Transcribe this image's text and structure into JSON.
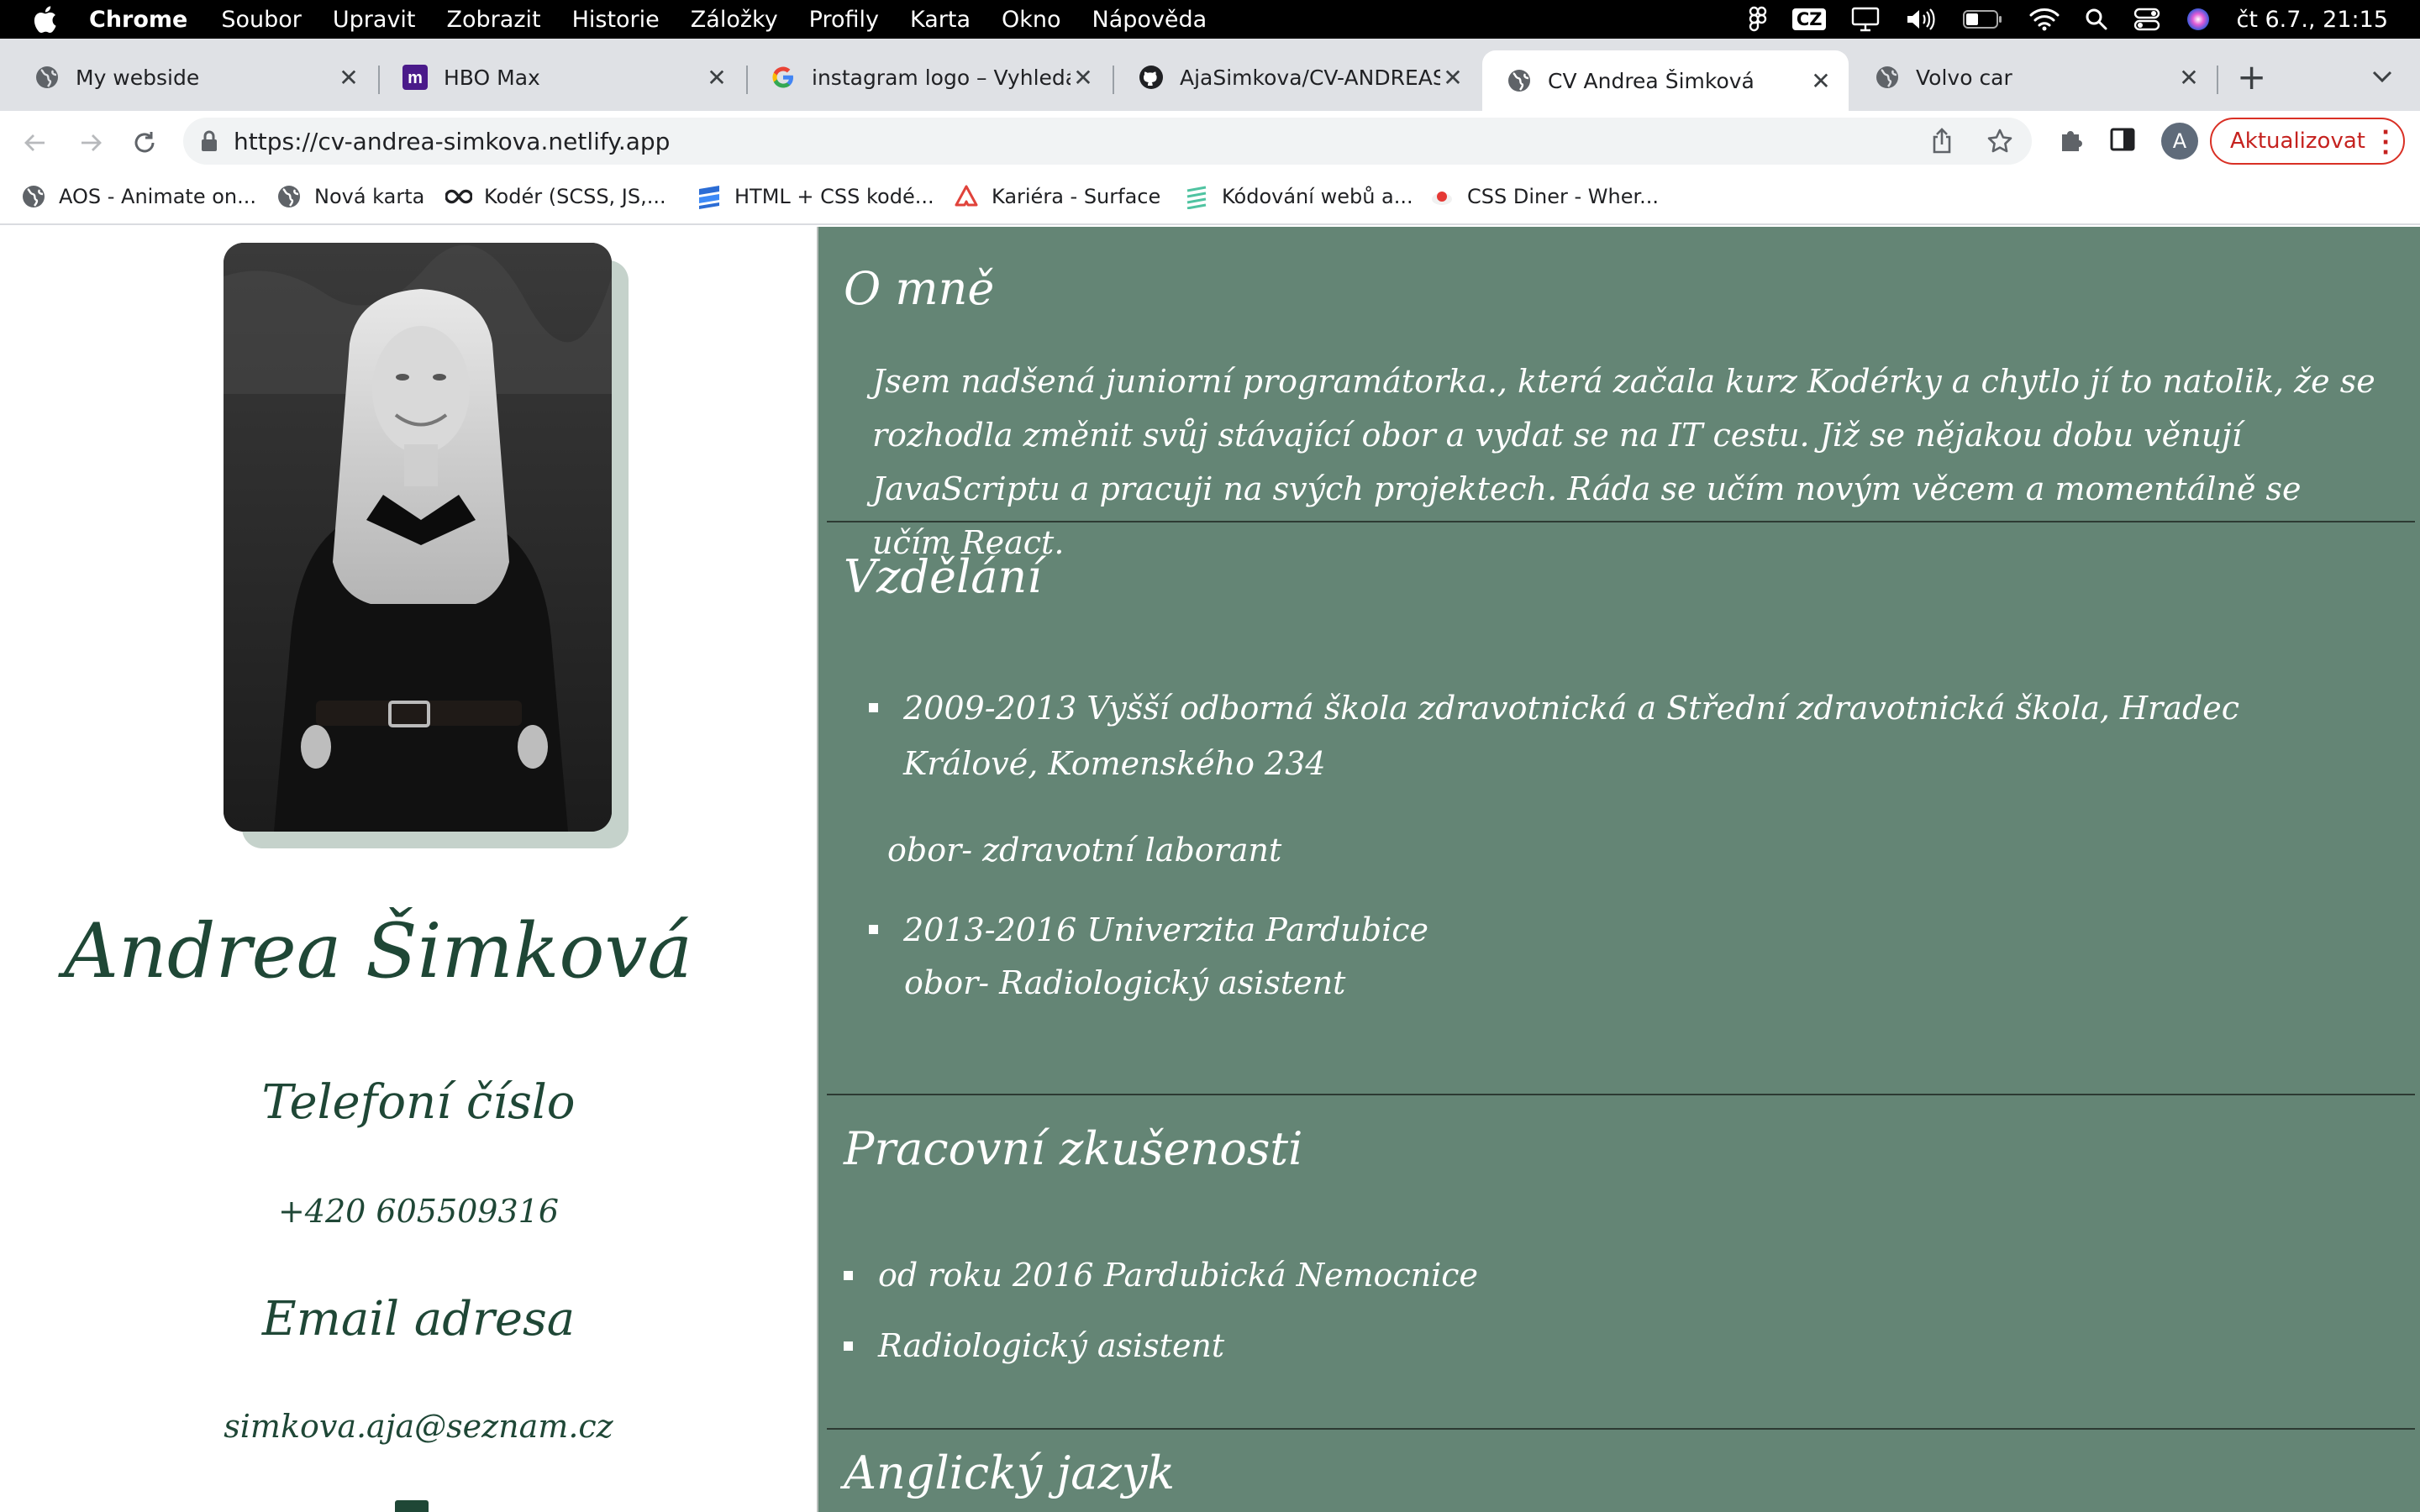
{
  "menubar": {
    "app_name": "Chrome",
    "items": [
      "Soubor",
      "Upravit",
      "Zobrazit",
      "Historie",
      "Záložky",
      "Profily",
      "Karta",
      "Okno",
      "Nápověda"
    ],
    "input_source": "CZ",
    "clock": "čt 6.7., 21:15"
  },
  "tabs": [
    {
      "label": "My webside",
      "icon": "globe-icon"
    },
    {
      "label": "HBO Max",
      "icon": "hbo-max-icon"
    },
    {
      "label": "instagram logo – Vyhledávání Google",
      "icon": "google-icon"
    },
    {
      "label": "AjaSimkova/CV-ANDREASIMKOVA",
      "icon": "github-icon"
    },
    {
      "label": "CV Andrea Šimková",
      "icon": "globe-icon"
    },
    {
      "label": "Volvo car",
      "icon": "globe-icon"
    }
  ],
  "active_tab_index": 4,
  "address_bar": {
    "url": "https://cv-andrea-simkova.netlify.app",
    "profile_initial": "A",
    "update_label": "Aktualizovat"
  },
  "bookmarks": [
    {
      "label": "AOS - Animate on...",
      "icon": "globe-icon"
    },
    {
      "label": "Nová karta",
      "icon": "globe-icon"
    },
    {
      "label": "Kodér (SCSS, JS,...",
      "icon": "infinity-icon"
    },
    {
      "label": "HTML + CSS kodé...",
      "icon": "layers-icon"
    },
    {
      "label": "Kariéra - Surface",
      "icon": "surface-icon"
    },
    {
      "label": "Kódování webů a...",
      "icon": "stripes-icon"
    },
    {
      "label": "CSS Diner - Wher...",
      "icon": "plate-icon"
    }
  ],
  "colors": {
    "sidebar_text": "#1f4736",
    "main_bg": "#648575",
    "update_accent": "#d93025"
  },
  "cv": {
    "name": "Andrea Šimková",
    "phone_label": "Telefoní číslo",
    "phone": "+420 605509316",
    "email_label": "Email adresa",
    "email": "simkova.aja@seznam.cz",
    "about_title": "O mně",
    "about_text": "Jsem nadšená juniorní programátorka., která začala kurz Kodérky a chytlo jí to natolik, že se rozhodla změnit svůj stávající obor a vydat se na IT cestu. Již se nějakou dobu věnují JavaScriptu a pracuji na svých projektech. Ráda se učím novým věcem a momentálně se učím React.",
    "education_title": "Vzdělání",
    "education": [
      {
        "text": "2009-2013 Vyšší odborná škola zdravotnická a Střední zdravotnická škola, Hradec Králové, Komenského 234",
        "field": "obor- zdravotní laborant"
      },
      {
        "text": "2013-2016 Univerzita Pardubice",
        "field": "obor- Radiologický asistent"
      }
    ],
    "work_title": "Pracovní zkušenosti",
    "work": [
      "od roku 2016 Pardubická Nemocnice",
      "Radiologický asistent"
    ],
    "english_title": "Anglický jazyk"
  }
}
